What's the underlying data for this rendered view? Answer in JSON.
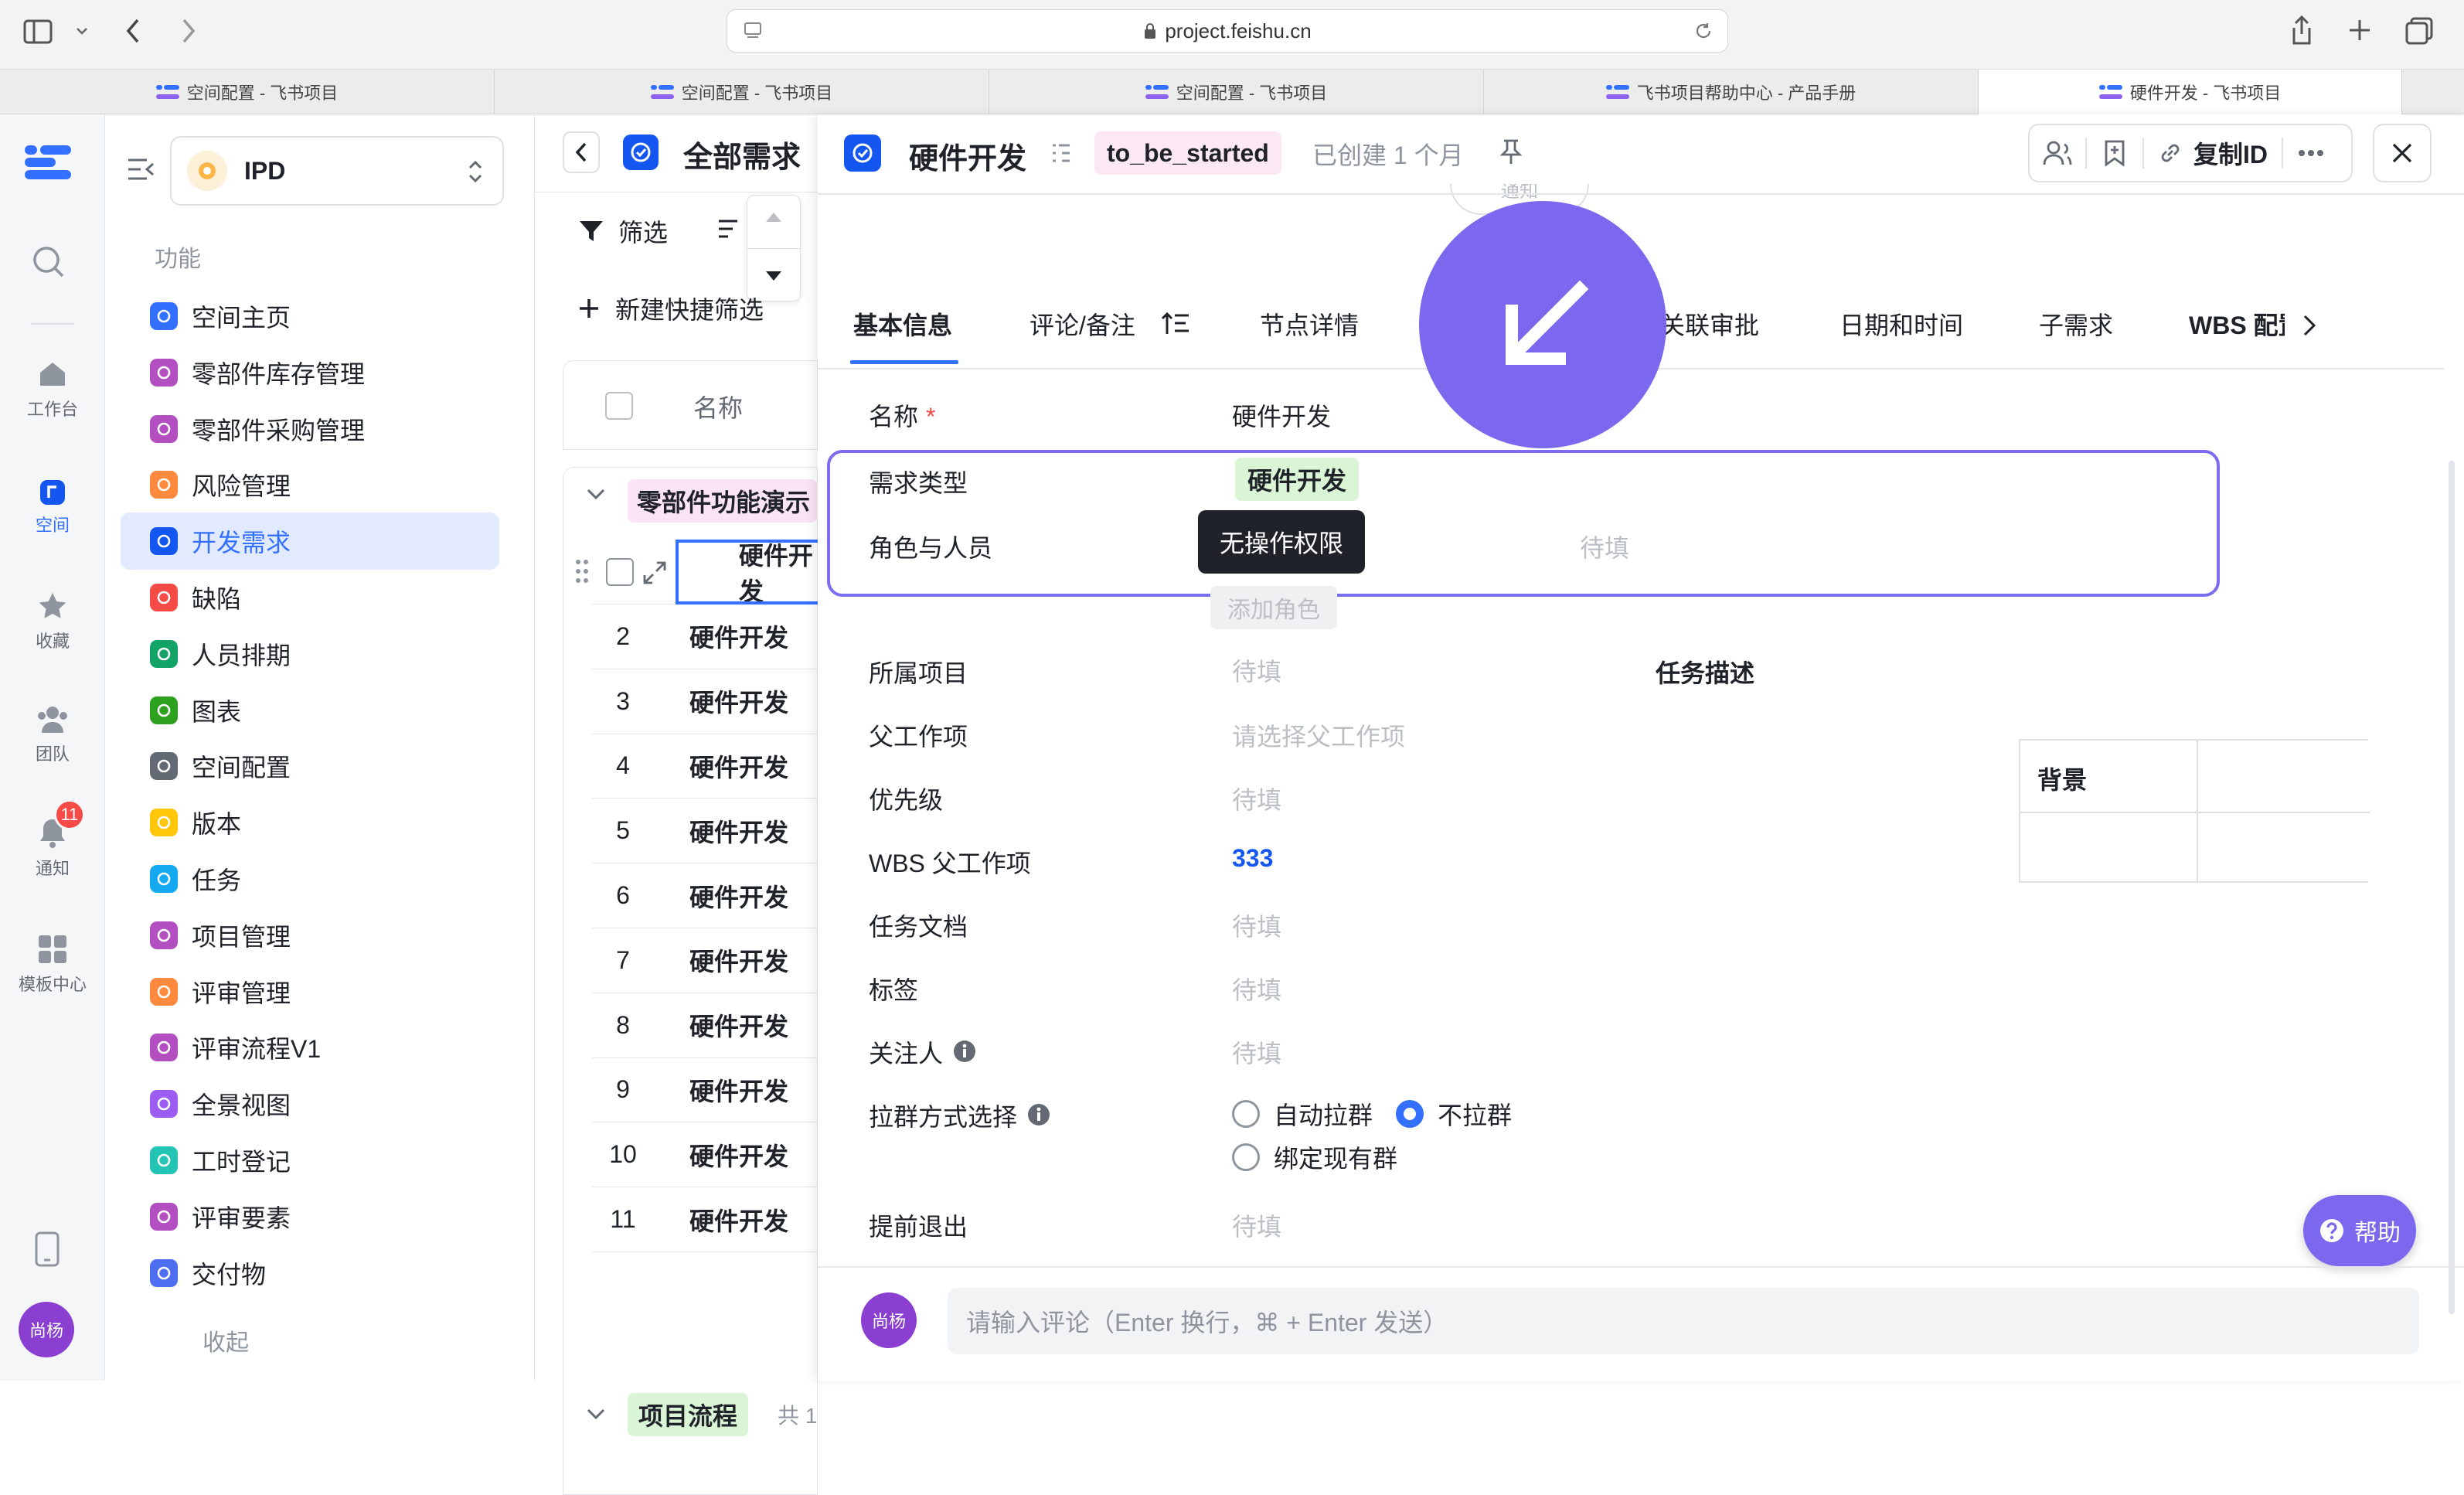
{
  "browser": {
    "url": "project.feishu.cn",
    "tabs": [
      {
        "label": "空间配置 - 飞书项目"
      },
      {
        "label": "空间配置 - 飞书项目"
      },
      {
        "label": "空间配置 - 飞书项目"
      },
      {
        "label": "飞书项目帮助中心 - 产品手册"
      },
      {
        "label": "硬件开发 - 飞书项目"
      }
    ]
  },
  "rail": {
    "items": [
      {
        "label": "工作台",
        "icon": "home-icon"
      },
      {
        "label": "空间",
        "icon": "space-icon"
      },
      {
        "label": "收藏",
        "icon": "star-icon"
      },
      {
        "label": "团队",
        "icon": "team-icon"
      },
      {
        "label": "通知",
        "icon": "bell-icon",
        "badge": "11"
      },
      {
        "label": "模板中心",
        "icon": "template-icon"
      }
    ],
    "avatar": "尚杨"
  },
  "sidebar": {
    "space_name": "IPD",
    "section_title": "功能",
    "items": [
      {
        "label": "空间主页",
        "color": "#3370ff"
      },
      {
        "label": "零部件库存管理",
        "color": "#b44fc2"
      },
      {
        "label": "零部件采购管理",
        "color": "#b44fc2"
      },
      {
        "label": "风险管理",
        "color": "#ff8a3d"
      },
      {
        "label": "开发需求",
        "color": "#1456f0"
      },
      {
        "label": "缺陷",
        "color": "#f54a45"
      },
      {
        "label": "人员排期",
        "color": "#14a366"
      },
      {
        "label": "图表",
        "color": "#2ea121"
      },
      {
        "label": "空间配置",
        "color": "#646a73"
      },
      {
        "label": "版本",
        "color": "#ffc60a"
      },
      {
        "label": "任务",
        "color": "#14a9f0"
      },
      {
        "label": "项目管理",
        "color": "#b44fc2"
      },
      {
        "label": "评审管理",
        "color": "#ff8a3d"
      },
      {
        "label": "评审流程V1",
        "color": "#b44fc2"
      },
      {
        "label": "全景视图",
        "color": "#9b5cf2"
      },
      {
        "label": "工时登记",
        "color": "#24c4b5"
      },
      {
        "label": "评审要素",
        "color": "#b44fc2"
      },
      {
        "label": "交付物",
        "color": "#4e6ef2"
      }
    ],
    "collapse_label": "收起"
  },
  "list": {
    "title": "全部需求",
    "filter_label": "筛选",
    "new_filter_label": "新建快捷筛选",
    "col_name": "名称",
    "group_label": "零部件功能演示",
    "rows": [
      {
        "num": "",
        "name": "硬件开发"
      },
      {
        "num": "2",
        "name": "硬件开发"
      },
      {
        "num": "3",
        "name": "硬件开发"
      },
      {
        "num": "4",
        "name": "硬件开发"
      },
      {
        "num": "5",
        "name": "硬件开发"
      },
      {
        "num": "6",
        "name": "硬件开发"
      },
      {
        "num": "7",
        "name": "硬件开发"
      },
      {
        "num": "8",
        "name": "硬件开发"
      },
      {
        "num": "9",
        "name": "硬件开发"
      },
      {
        "num": "10",
        "name": "硬件开发"
      },
      {
        "num": "11",
        "name": "硬件开发"
      }
    ],
    "group2_label": "项目流程",
    "group2_count": "共 1"
  },
  "detail": {
    "title": "硬件开发",
    "status": "to_be_started",
    "created": "已创建 1 个月",
    "copy_id_label": "复制ID",
    "partial_chip": "通知",
    "tabs": [
      "基本信息",
      "评论/备注",
      "节点详情",
      "关联审批",
      "日期和时间",
      "子需求",
      "WBS 配置"
    ],
    "fields": {
      "name_label": "名称",
      "name_value": "硬件开发",
      "type_label": "需求类型",
      "type_value": "硬件开发",
      "role_label": "角色与人员",
      "role_placeholder": "待填",
      "tooltip": "无操作权限",
      "add_role": "添加角色",
      "project_label": "所属项目",
      "project_value": "待填",
      "task_desc_label": "任务描述",
      "parent_label": "父工作项",
      "parent_placeholder": "请选择父工作项",
      "priority_label": "优先级",
      "priority_value": "待填",
      "wbs_parent_label": "WBS 父工作项",
      "wbs_parent_value": "333",
      "task_doc_label": "任务文档",
      "task_doc_value": "待填",
      "tag_label": "标签",
      "tag_value": "待填",
      "watcher_label": "关注人",
      "watcher_value": "待填",
      "group_label": "拉群方式选择",
      "radio_auto": "自动拉群",
      "radio_none": "不拉群",
      "radio_bind": "绑定现有群",
      "exit_label": "提前退出",
      "exit_value": "待填",
      "background_header": "背景"
    },
    "comment_placeholder": "请输入评论（Enter 换行，⌘ + Enter 发送）",
    "comment_avatar": "尚杨",
    "help_label": "帮助"
  },
  "colors": {
    "accent": "#3370ff",
    "highlight_border": "#7b6cf0",
    "arrow_circle": "#7b68ee",
    "status_bg": "#fce8f3",
    "type_tag_bg": "#d9f5d6"
  }
}
